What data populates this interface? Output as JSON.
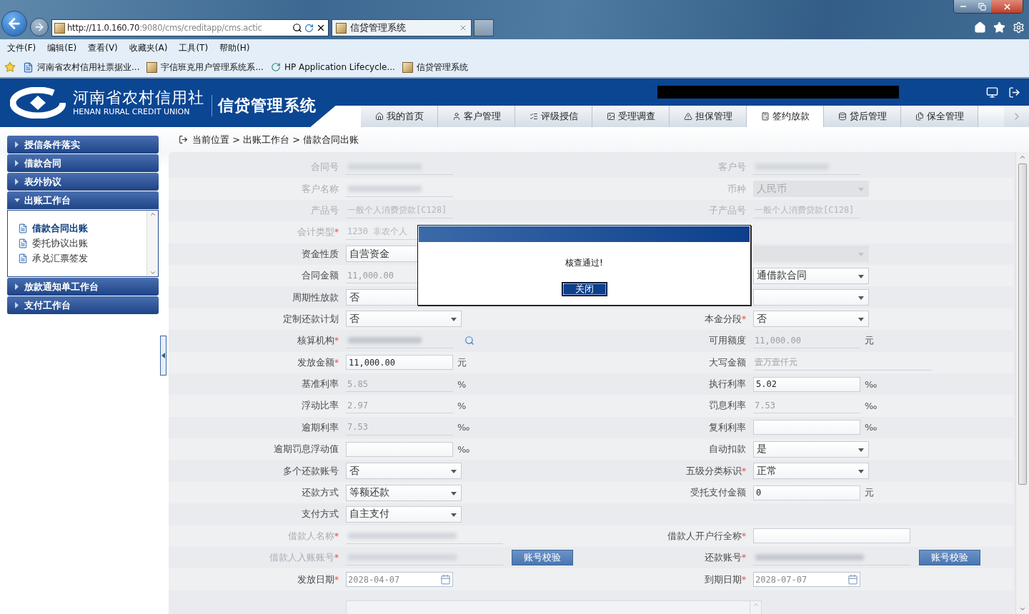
{
  "browser": {
    "address_host": "http://11.0.160.70",
    "address_rest": ":9080/cms/creditapp/cms.actic",
    "tabs": [
      {
        "label": "信贷管理系统",
        "selected": true
      }
    ],
    "menu": [
      "文件(F)",
      "编辑(E)",
      "查看(V)",
      "收藏夹(A)",
      "工具(T)",
      "帮助(H)"
    ],
    "favorites": [
      "河南省农村信用社票据业...",
      "宇信班克用户管理系统系...",
      "HP Application Lifecycle...",
      "信贷管理系统"
    ]
  },
  "app": {
    "org_name": "河南省农村信用社",
    "org_name_en": "HENAN RURAL CREDIT UNION",
    "system_name": "信贷管理系统",
    "nav_tabs": [
      {
        "label": "我的首页",
        "selected": false
      },
      {
        "label": "客户管理",
        "selected": false
      },
      {
        "label": "评级授信",
        "selected": false
      },
      {
        "label": "受理调查",
        "selected": false
      },
      {
        "label": "担保管理",
        "selected": false
      },
      {
        "label": "签约放款",
        "selected": true
      },
      {
        "label": "贷后管理",
        "selected": false
      },
      {
        "label": "保全管理",
        "selected": false
      }
    ]
  },
  "sidebar": {
    "items": [
      {
        "label": "授信条件落实",
        "expanded": false
      },
      {
        "label": "借款合同",
        "expanded": false
      },
      {
        "label": "表外协议",
        "expanded": false
      },
      {
        "label": "出账工作台",
        "expanded": true,
        "children": [
          {
            "label": "借款合同出账",
            "selected": true
          },
          {
            "label": "委托协议出账",
            "selected": false
          },
          {
            "label": "承兑汇票签发",
            "selected": false
          }
        ]
      },
      {
        "label": "放款通知单工作台",
        "expanded": false
      },
      {
        "label": "支付工作台",
        "expanded": false
      }
    ]
  },
  "breadcrumb": "当前位置 > 出账工作台 > 借款合同出账",
  "form": {
    "rows": [
      {
        "left": {
          "label": "合同号",
          "kind": "redacted",
          "disabled": true
        },
        "right": {
          "label": "客户号",
          "kind": "redacted",
          "disabled": true
        }
      },
      {
        "left": {
          "label": "客户名称",
          "kind": "redacted",
          "disabled": true
        },
        "right": {
          "label": "币种",
          "kind": "select",
          "value": "人民币",
          "disabled": true
        }
      },
      {
        "left": {
          "label": "产品号",
          "kind": "plain",
          "value": "一般个人消费贷款[C128]",
          "disabled": true
        },
        "right": {
          "label": "子产品号",
          "kind": "plain",
          "value": "一般个人消费贷款[C128]",
          "disabled": true
        }
      },
      {
        "left": {
          "label": "会计类型",
          "mark": "*",
          "kind": "plain",
          "value": "1230 非农个人",
          "disabled": true
        },
        "right": null
      },
      {
        "left": {
          "label": "资金性质",
          "kind": "select",
          "value": "自营资金",
          "disabled": false
        },
        "right": {
          "kind": "select",
          "disabled": true
        }
      },
      {
        "left": {
          "label": "合同金额",
          "kind": "plain",
          "value": "11,000.00",
          "disabled": false
        },
        "right": {
          "kind": "select",
          "value": "通借款合同",
          "disabled": false
        }
      },
      {
        "left": {
          "label": "周期性放款",
          "kind": "select",
          "value": "否",
          "disabled": false
        },
        "right": {
          "kind": "select",
          "disabled": false
        }
      },
      {
        "left": {
          "label": "定制还款计划",
          "kind": "select",
          "value": "否",
          "disabled": false
        },
        "right": {
          "label": "本金分段",
          "mark": "*",
          "kind": "select",
          "value": "否",
          "disabled": false
        }
      },
      {
        "left": {
          "label": "核算机构",
          "mark": "*",
          "kind": "redacted",
          "lookup": true,
          "disabled": false
        },
        "right": {
          "label": "可用额度",
          "kind": "plain",
          "value": "11,000.00",
          "unit": "元",
          "disabled": false
        }
      },
      {
        "left": {
          "label": "发放金额",
          "mark": "*",
          "kind": "input",
          "value": "11,000.00",
          "unit": "元",
          "disabled": false
        },
        "right": {
          "label": "大写金额",
          "kind": "plain",
          "value": "壹万壹仟元",
          "wide": true,
          "disabled": false
        }
      },
      {
        "left": {
          "label": "基准利率",
          "kind": "plain",
          "value": "5.85",
          "unit": "%",
          "disabled": false
        },
        "right": {
          "label": "执行利率",
          "kind": "input",
          "value": "5.02",
          "unit": "‰",
          "disabled": false
        }
      },
      {
        "left": {
          "label": "浮动比率",
          "kind": "plain",
          "value": "2.97",
          "unit": "%",
          "disabled": false
        },
        "right": {
          "label": "罚息利率",
          "kind": "plain",
          "value": "7.53",
          "unit": "‰",
          "disabled": false
        }
      },
      {
        "left": {
          "label": "逾期利率",
          "kind": "plain",
          "value": "7.53",
          "unit": "‰",
          "disabled": false
        },
        "right": {
          "label": "复利利率",
          "kind": "input",
          "unit": "‰",
          "disabled": false
        }
      },
      {
        "left": {
          "label": "逾期罚息浮动值",
          "kind": "input",
          "unit": "‰",
          "disabled": false
        },
        "right": {
          "label": "自动扣款",
          "kind": "select",
          "value": "是",
          "disabled": false
        }
      },
      {
        "left": {
          "label": "多个还款账号",
          "kind": "select",
          "value": "否",
          "disabled": false
        },
        "right": {
          "label": "五级分类标识",
          "mark": "*",
          "kind": "select",
          "value": "正常",
          "disabled": false
        }
      },
      {
        "left": {
          "label": "还款方式",
          "kind": "select",
          "value": "等额还款",
          "disabled": false
        },
        "right": {
          "label": "受托支付金额",
          "kind": "input",
          "value": "0",
          "unit": "元",
          "disabled": false
        }
      },
      {
        "left": {
          "label": "支付方式",
          "kind": "select",
          "value": "自主支付",
          "disabled": false
        },
        "right": null
      },
      {
        "left": {
          "label": "借款人名称",
          "mark": "*",
          "kind": "redacted",
          "wide": true,
          "disabled": true
        },
        "right": {
          "label": "借款人开户行全称",
          "mark": "*",
          "kind": "input",
          "wide": true,
          "disabled": false
        }
      },
      {
        "left": {
          "label": "借款人入账账号",
          "mark": "*",
          "kind": "redacted",
          "wide": true,
          "button": "账号校验",
          "disabled": true
        },
        "right": {
          "label": "还款账号",
          "mark": "*",
          "kind": "redacted",
          "wide": true,
          "button": "账号校验",
          "disabled": false
        }
      },
      {
        "left": {
          "label": "发放日期",
          "mark": "*",
          "kind": "date",
          "value": "2028-04-07",
          "disabled": false
        },
        "right": {
          "label": "到期日期",
          "mark": "*",
          "kind": "date",
          "value": "2028-07-07",
          "disabled": false
        }
      },
      {
        "left": {
          "kind": "textarea"
        },
        "right": null
      }
    ]
  },
  "dialog": {
    "message": "核查通过!",
    "button": "关闭"
  }
}
